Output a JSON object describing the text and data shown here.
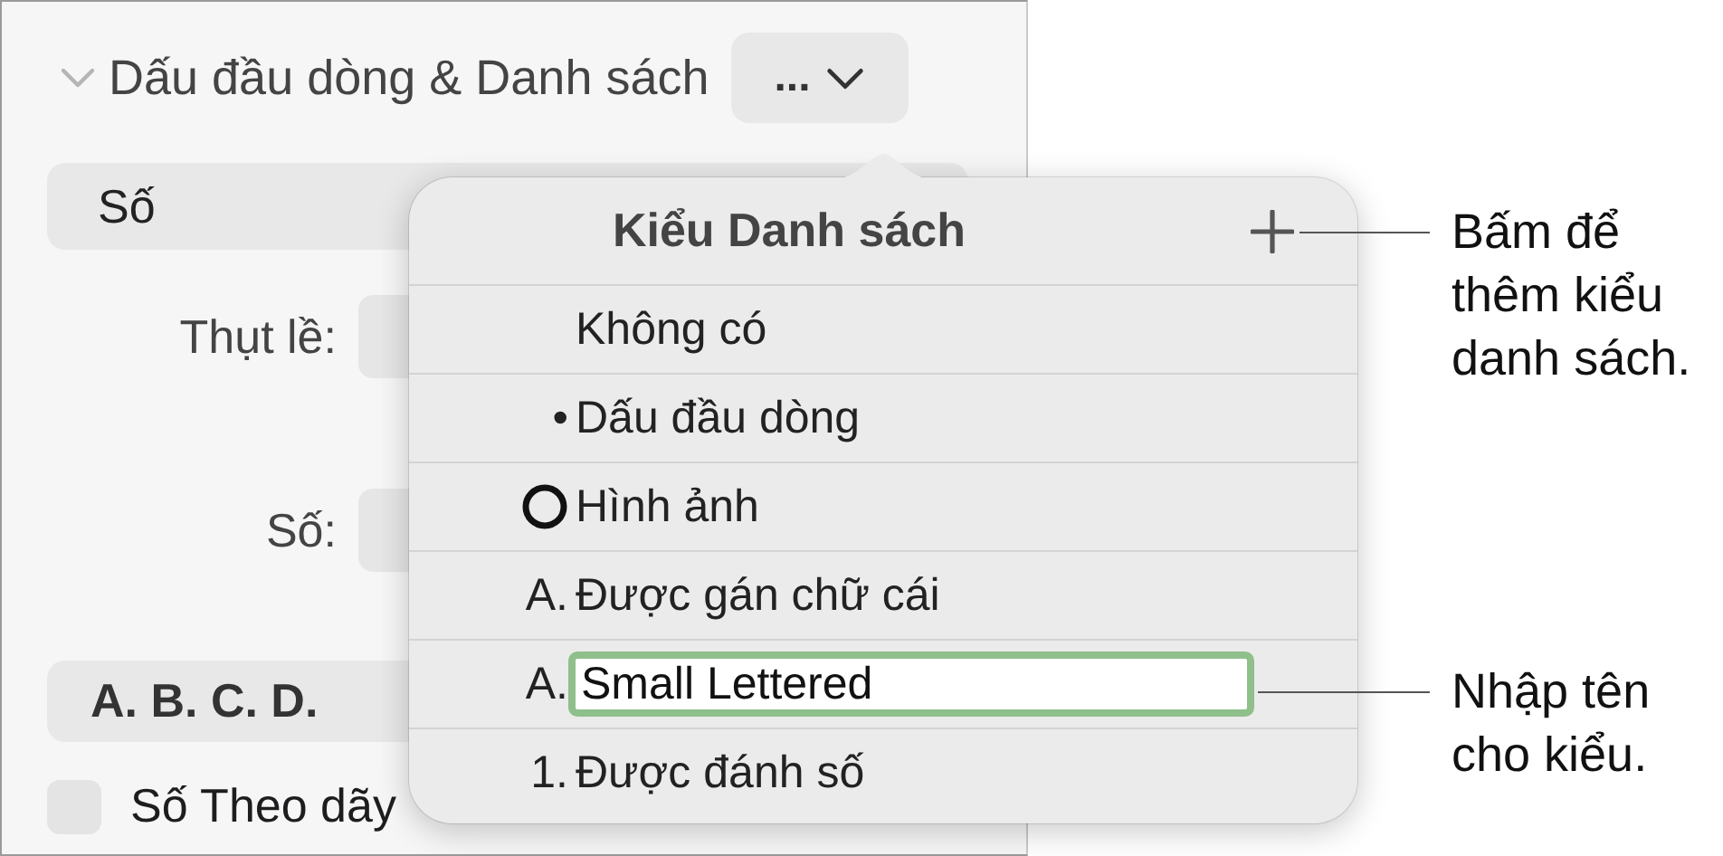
{
  "section": {
    "title": "Dấu đầu dòng & Danh sách",
    "expanded": true,
    "menu_button": "..."
  },
  "list_type": "Số",
  "fields": [
    {
      "label": "Thụt lề:"
    },
    {
      "label": "Số:"
    }
  ],
  "format": "A. B. C. D.",
  "sequence_checkbox": {
    "label": "Số Theo dãy",
    "checked": false
  },
  "popover": {
    "title": "Kiểu Danh sách",
    "styles": [
      {
        "kind": "plain",
        "label": "Không có"
      },
      {
        "kind": "plain",
        "prefix": "•",
        "label": "Dấu đầu dòng"
      },
      {
        "kind": "image",
        "label": "Hình ảnh"
      },
      {
        "kind": "plain",
        "prefix": "A.",
        "label": "Được gán chữ cái"
      },
      {
        "kind": "editing",
        "prefix": "A.",
        "value": "Small Lettered"
      },
      {
        "kind": "plain",
        "prefix": "1.",
        "label": "Được đánh số"
      }
    ]
  },
  "callouts": [
    {
      "text": "Bấm để thêm kiểu danh sách."
    },
    {
      "text": "Nhập tên cho kiểu."
    }
  ]
}
